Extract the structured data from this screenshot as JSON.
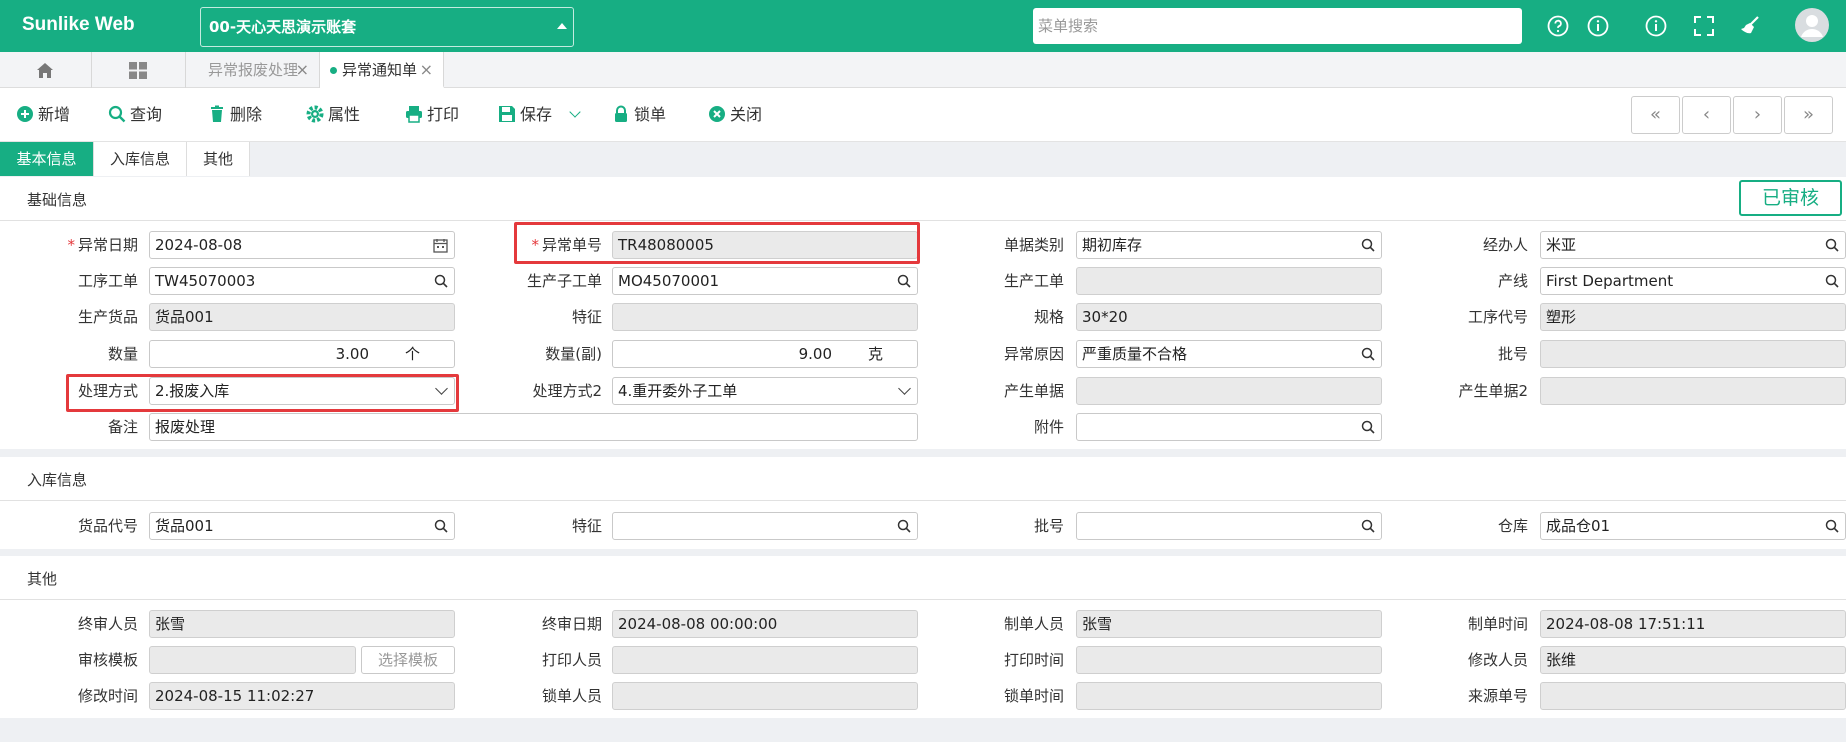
{
  "header": {
    "logo": "Sunlike Web",
    "account": "00-天心天思演示账套",
    "menu_search_placeholder": "菜单搜索",
    "icons": [
      "help-icon",
      "info-icon",
      "about-icon",
      "fullscreen-icon",
      "broom-icon",
      "user-avatar-icon"
    ]
  },
  "tabs": [
    {
      "label": "异常报废处理",
      "active": false
    },
    {
      "label": "异常通知单",
      "active": true
    }
  ],
  "toolbar": {
    "new": "新增",
    "query": "查询",
    "delete": "删除",
    "properties": "属性",
    "print": "打印",
    "save": "保存",
    "lock": "锁单",
    "close": "关闭",
    "nav": [
      "«",
      "‹",
      "›",
      "»"
    ]
  },
  "subtabs": [
    "基本信息",
    "入库信息",
    "其他"
  ],
  "status_badge": "已审核",
  "sections": {
    "basic": "基础信息",
    "inbound": "入库信息",
    "other": "其他"
  },
  "basic": {
    "exception_date": {
      "label": "异常日期",
      "value": "2024-08-08"
    },
    "exception_no": {
      "label": "异常单号",
      "value": "TR48080005"
    },
    "doc_type": {
      "label": "单据类别",
      "value": "期初库存"
    },
    "handler": {
      "label": "经办人",
      "value": "米亚"
    },
    "process_wo": {
      "label": "工序工单",
      "value": "TW45070003"
    },
    "sub_wo": {
      "label": "生产子工单",
      "value": "MO45070001"
    },
    "prod_wo": {
      "label": "生产工单",
      "value": ""
    },
    "line": {
      "label": "产线",
      "value": "First Department"
    },
    "prod_item": {
      "label": "生产货品",
      "value": "货品001"
    },
    "feature": {
      "label": "特征",
      "value": ""
    },
    "spec": {
      "label": "规格",
      "value": "30*20"
    },
    "process_code": {
      "label": "工序代号",
      "value": "塑形"
    },
    "qty": {
      "label": "数量",
      "value": "3.00",
      "unit": "个"
    },
    "qty_sub": {
      "label": "数量(副)",
      "value": "9.00",
      "unit": "克"
    },
    "reason": {
      "label": "异常原因",
      "value": "严重质量不合格"
    },
    "batch": {
      "label": "批号",
      "value": ""
    },
    "method": {
      "label": "处理方式",
      "value": "2.报废入库"
    },
    "method2": {
      "label": "处理方式2",
      "value": "4.重开委外子工单"
    },
    "gen_doc": {
      "label": "产生单据",
      "value": ""
    },
    "gen_doc2": {
      "label": "产生单据2",
      "value": ""
    },
    "remark": {
      "label": "备注",
      "value": "报废处理"
    },
    "attachment": {
      "label": "附件",
      "value": ""
    }
  },
  "inbound": {
    "item_code": {
      "label": "货品代号",
      "value": "货品001"
    },
    "feature": {
      "label": "特征",
      "value": ""
    },
    "batch": {
      "label": "批号",
      "value": ""
    },
    "warehouse": {
      "label": "仓库",
      "value": "成品仓01"
    }
  },
  "other": {
    "final_reviewer": {
      "label": "终审人员",
      "value": "张雪"
    },
    "final_date": {
      "label": "终审日期",
      "value": "2024-08-08 00:00:00"
    },
    "creator": {
      "label": "制单人员",
      "value": "张雪"
    },
    "create_time": {
      "label": "制单时间",
      "value": "2024-08-08 17:51:11"
    },
    "review_template": {
      "label": "审核模板",
      "value": "",
      "button": "选择模板"
    },
    "printer": {
      "label": "打印人员",
      "value": ""
    },
    "print_time": {
      "label": "打印时间",
      "value": ""
    },
    "modifier": {
      "label": "修改人员",
      "value": "张维"
    },
    "modify_time": {
      "label": "修改时间",
      "value": "2024-08-15 11:02:27"
    },
    "locker": {
      "label": "锁单人员",
      "value": ""
    },
    "lock_time": {
      "label": "锁单时间",
      "value": ""
    },
    "source_no": {
      "label": "来源单号",
      "value": ""
    }
  },
  "colors": {
    "accent": "#17ae83",
    "highlight": "#e4393c"
  }
}
